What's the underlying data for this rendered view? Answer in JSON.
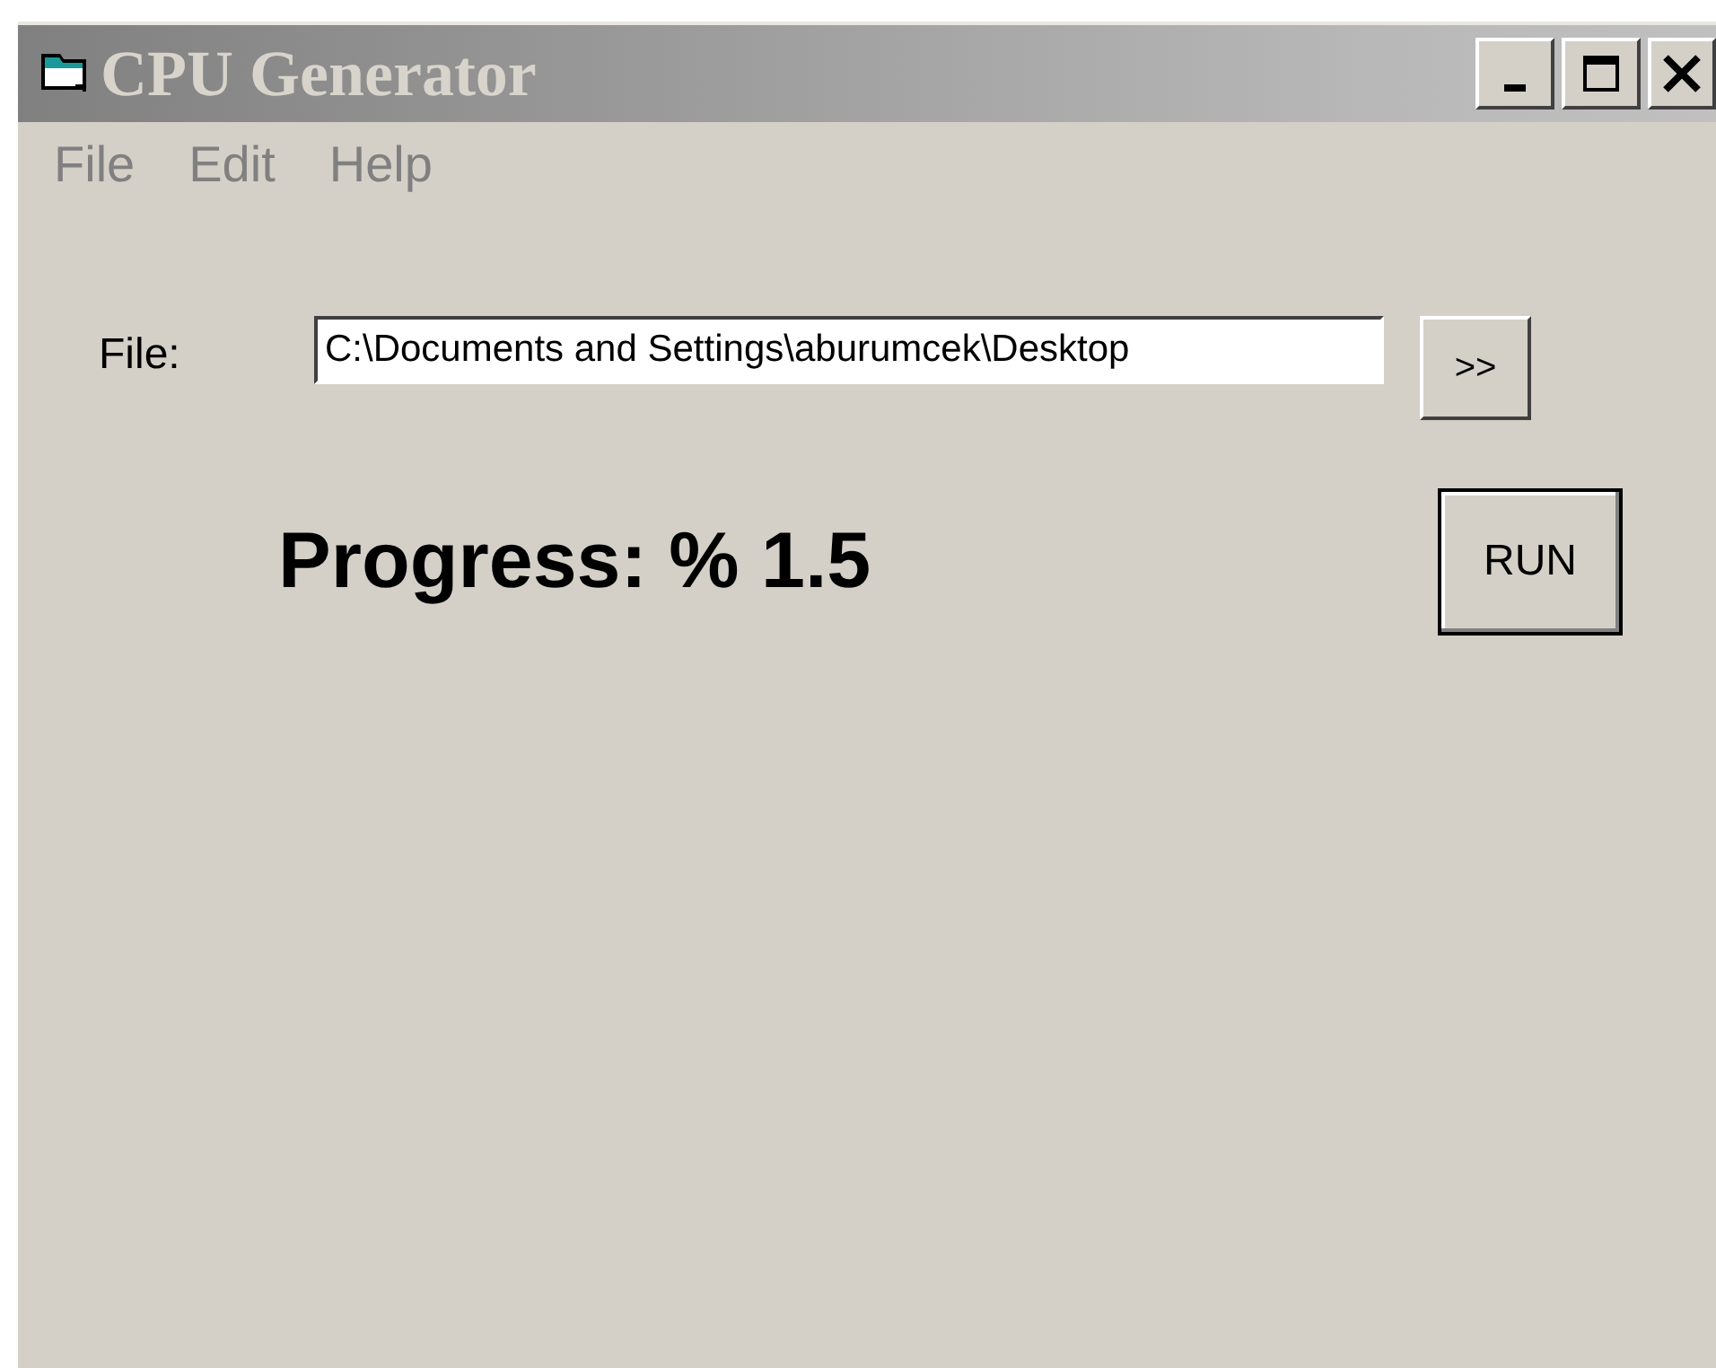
{
  "window": {
    "title": "CPU Generator"
  },
  "menu": [
    "File",
    "Edit",
    "Help"
  ],
  "file_field": {
    "label": "File:",
    "value": "C:\\Documents and Settings\\aburumcek\\Desktop"
  },
  "browse_button": ">>",
  "progress": "Progress: % 1.5",
  "run_button": "RUN"
}
